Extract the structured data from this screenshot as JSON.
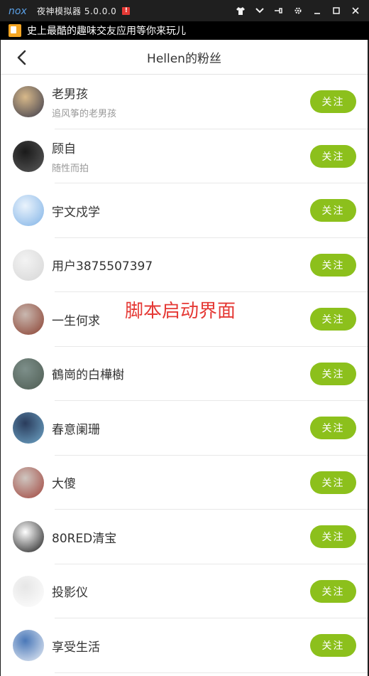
{
  "emulator": {
    "title": "夜神模拟器 5.0.0.0",
    "badge": "!",
    "logo_text": "nox"
  },
  "ad_banner": {
    "text": "史上最酷的趣味交友应用等你来玩儿"
  },
  "nav": {
    "title": "Hellen的粉丝"
  },
  "follow_label": "关注",
  "overlay_label": "脚本启动界面",
  "users": [
    {
      "name": "老男孩",
      "sub": "追风筝的老男孩",
      "avatar_colors": [
        "#d8b98a",
        "#3a3a4a"
      ]
    },
    {
      "name": "顾自",
      "sub": "随性而拍",
      "avatar_colors": [
        "#1a1a1a",
        "#5a5a5a"
      ]
    },
    {
      "name": "宇文戍学",
      "sub": "",
      "avatar_colors": [
        "#eaf3fc",
        "#7fb2e6"
      ]
    },
    {
      "name": "用户3875507397",
      "sub": "",
      "avatar_colors": [
        "#f3f3f3",
        "#d6d6d6"
      ]
    },
    {
      "name": "一生何求",
      "sub": "",
      "avatar_colors": [
        "#c9b8b0",
        "#8a4030"
      ]
    },
    {
      "name": "鶴崗的白樺樹",
      "sub": "",
      "avatar_colors": [
        "#7d8f8a",
        "#4e5c52"
      ]
    },
    {
      "name": "春意阑珊",
      "sub": "",
      "avatar_colors": [
        "#2a3c5c",
        "#6fa6c8"
      ]
    },
    {
      "name": "大傻",
      "sub": "",
      "avatar_colors": [
        "#cfc6c0",
        "#a0443c"
      ]
    },
    {
      "name": "80RED清宝",
      "sub": "",
      "avatar_colors": [
        "#ffffff",
        "#1a1a1a"
      ]
    },
    {
      "name": "投影仪",
      "sub": "",
      "avatar_colors": [
        "#e6e6e6",
        "#ffffff"
      ]
    },
    {
      "name": "享受生活",
      "sub": "",
      "avatar_colors": [
        "#4a78b8",
        "#e9eef6"
      ]
    }
  ]
}
